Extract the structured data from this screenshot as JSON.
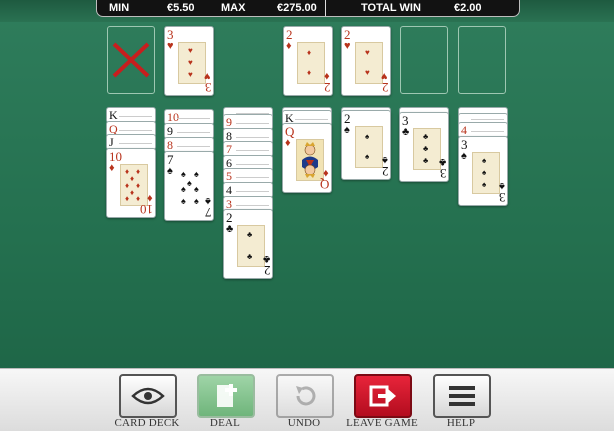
{
  "hud": {
    "min_label": "MIN",
    "min_value": "€5.50",
    "max_label": "MAX",
    "max_value": "€275.00",
    "total_label": "TOTAL WIN",
    "total_value": "€2.00"
  },
  "colors": {
    "table": "#24704f",
    "red_suit": "#b8331c",
    "black_suit": "#111111"
  },
  "stock": {
    "state": "empty",
    "icon": "red-x-icon"
  },
  "waste": {
    "rank": "3",
    "suit": "♥"
  },
  "foundations": [
    {
      "rank": "2",
      "suit": "♦"
    },
    {
      "rank": "2",
      "suit": "♥"
    },
    {
      "rank": "",
      "suit": ""
    },
    {
      "rank": "",
      "suit": ""
    }
  ],
  "tableau": [
    {
      "cards": [
        {
          "rank": "K",
          "suit": "♥"
        },
        {
          "rank": "Q",
          "suit": "♦"
        },
        {
          "rank": "J",
          "suit": "♠"
        },
        {
          "rank": "10",
          "suit": "♦"
        }
      ]
    },
    {
      "cards": [
        {
          "rank": "10",
          "suit": "♦"
        },
        {
          "rank": "9",
          "suit": "♠"
        },
        {
          "rank": "8",
          "suit": "♦"
        },
        {
          "rank": "7",
          "suit": "♠"
        }
      ]
    },
    {
      "cards": [
        {
          "rank": "9",
          "suit": "♦"
        },
        {
          "rank": "8",
          "suit": "♠"
        },
        {
          "rank": "7",
          "suit": "♦"
        },
        {
          "rank": "6",
          "suit": "♠"
        },
        {
          "rank": "5",
          "suit": "♦"
        },
        {
          "rank": "4",
          "suit": "♠"
        },
        {
          "rank": "3",
          "suit": "♦"
        },
        {
          "rank": "2",
          "suit": "♣"
        }
      ]
    },
    {
      "cards": [
        {
          "rank": "K",
          "suit": "♦"
        },
        {
          "rank": "Q",
          "suit": "♦"
        }
      ]
    },
    {
      "cards": [
        {
          "rank": "2",
          "suit": "♠"
        }
      ]
    },
    {
      "cards": [
        {
          "rank": "3",
          "suit": "♣"
        }
      ]
    },
    {
      "cards": [
        {
          "rank": "4",
          "suit": "♦"
        },
        {
          "rank": "3",
          "suit": "♠"
        }
      ]
    }
  ],
  "toolbar": {
    "card_deck": "CARD DECK",
    "deal": "DEAL",
    "undo": "UNDO",
    "leave_game": "LEAVE GAME",
    "help": "HELP"
  }
}
